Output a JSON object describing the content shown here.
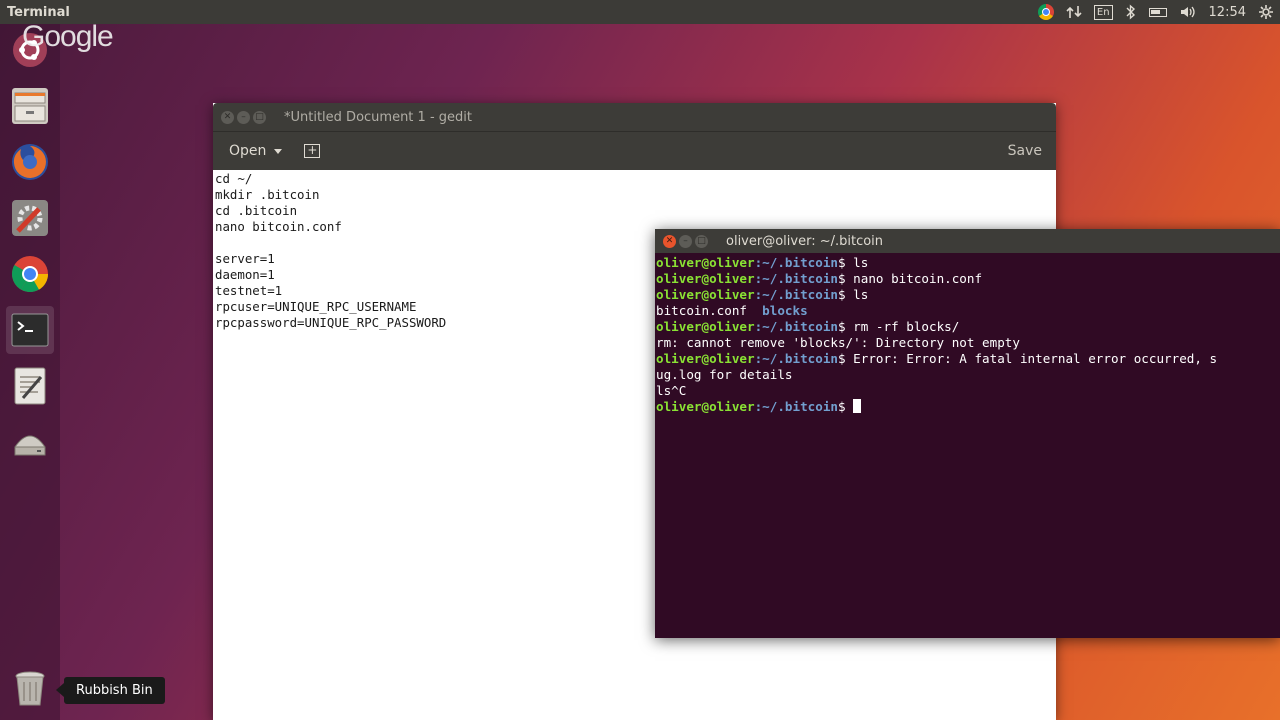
{
  "top_panel": {
    "title": "Terminal",
    "keyboard": "En",
    "clock": "12:54"
  },
  "launcher": {
    "google_text": "Google",
    "tooltip": "Rubbish Bin"
  },
  "gedit": {
    "title": "*Untitled Document 1 - gedit",
    "open_label": "Open",
    "save_label": "Save",
    "lines": [
      "cd ~/",
      "mkdir .bitcoin",
      "cd .bitcoin",
      "nano bitcoin.conf",
      "",
      "server=1",
      "daemon=1",
      "testnet=1",
      "rpcuser=UNIQUE_RPC_USERNAME",
      "rpcpassword=UNIQUE_RPC_PASSWORD"
    ]
  },
  "terminal": {
    "title": "oliver@oliver: ~/.bitcoin",
    "prompt_user": "oliver@oliver",
    "prompt_path": ":~/.bitcoin",
    "prompt_dollar": "$",
    "lines": [
      {
        "type": "cmd",
        "text": " ls"
      },
      {
        "type": "cmd",
        "text": " nano bitcoin.conf"
      },
      {
        "type": "cmd",
        "text": " ls"
      },
      {
        "type": "ls",
        "file": "bitcoin.conf",
        "dir": "blocks"
      },
      {
        "type": "cmd",
        "text": " rm -rf blocks/"
      },
      {
        "type": "out",
        "text": "rm: cannot remove 'blocks/': Directory not empty"
      },
      {
        "type": "cmd",
        "text": " Error: Error: A fatal internal error occurred, s"
      },
      {
        "type": "out",
        "text": "ug.log for details"
      },
      {
        "type": "out",
        "text": "ls^C"
      },
      {
        "type": "prompt",
        "text": " "
      }
    ]
  },
  "colors": {
    "terminal_bg": "#300a24",
    "prompt_green": "#8ae234",
    "prompt_blue": "#729fcf",
    "panel": "#3c3b37"
  }
}
